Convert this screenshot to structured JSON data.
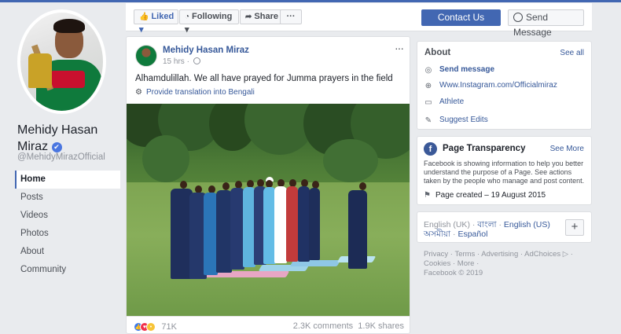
{
  "page": {
    "name_line1": "Mehidy Hasan",
    "name_line2": "Miraz",
    "handle": "@MehidyMirazOfficial",
    "verified_icon": "✔"
  },
  "nav": {
    "items": [
      "Home",
      "Posts",
      "Videos",
      "Photos",
      "About",
      "Community"
    ],
    "active": "Home"
  },
  "actionbar": {
    "liked": "Liked",
    "following": "Following",
    "share": "Share",
    "more": "···",
    "contact": "Contact Us",
    "send_message": "Send Message"
  },
  "post": {
    "author": "Mehidy Hasan Miraz",
    "time": "15 hrs",
    "text": "Alhamdulillah. We all have prayed for Jumma prayers in the field",
    "translate": "Provide translation into Bengali",
    "reaction_count": "71K",
    "comments": "2.3K comments",
    "shares": "1.9K shares",
    "more": "···"
  },
  "about": {
    "title": "About",
    "see_all": "See all",
    "send_message": "Send message",
    "instagram": "Www.Instagram.com/Officialmiraz",
    "category": "Athlete",
    "suggest_edits": "Suggest Edits"
  },
  "transparency": {
    "title": "Page Transparency",
    "see_more": "See More",
    "description": "Facebook is showing information to help you better understand the purpose of a Page. See actions taken by the people who manage and post content.",
    "created": "Page created – 19 August 2015"
  },
  "languages": {
    "current": "English (UK)",
    "sep": " · ",
    "bangla": "বাংলা",
    "english_us": "English (US)",
    "assamese": "অসমীয়া",
    "spanish": "Español",
    "plus": "+"
  },
  "footer": {
    "privacy": "Privacy",
    "terms": "Terms",
    "advertising": "Advertising",
    "adchoices": "AdChoices",
    "cookies": "Cookies",
    "more": "More",
    "copyright": "Facebook © 2019"
  },
  "colors": {
    "brand": "#4267b2",
    "link": "#365899",
    "background": "#e9ebee"
  }
}
